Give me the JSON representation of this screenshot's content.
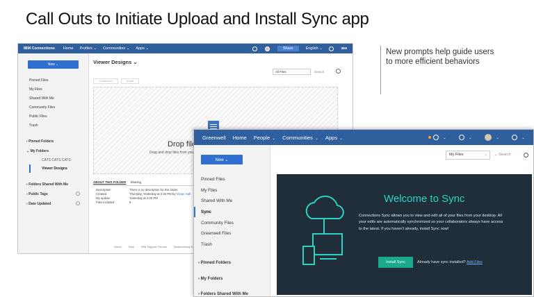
{
  "slide": {
    "title": "Call Outs to Initiate Upload and Install Sync app",
    "callout": "New prompts help guide users to more efficient behaviors"
  },
  "back_window": {
    "nav": {
      "brand": "IBM Connections",
      "items": [
        "Home",
        "Profiles ⌄",
        "Communities ⌄",
        "Apps ⌄"
      ],
      "share": "Share",
      "language": "English ⌄",
      "ibm_logo": "IBM"
    },
    "sidebar": {
      "new_button": "New ⌄",
      "items": [
        "Pinned Files",
        "My Files",
        "Shared With Me",
        "Community Files",
        "Public Files",
        "Trash"
      ],
      "pinned_folders": "Pinned Folders",
      "my_folders": "My Folders",
      "folder_items": [
        "CATS CATS CATS",
        "Viewer Designs"
      ],
      "folders_shared": "Folders Shared With Me",
      "public_tags": "Public Tags",
      "date_updated": "Date Updated"
    },
    "main": {
      "heading": "Viewer Designs ⌄",
      "filter": "All Files",
      "search_placeholder": "Search",
      "btn1": "Download",
      "btn2": "Share",
      "drop_title": "Drop files here",
      "drop_sub": "Drag and drop files from your desktop",
      "tab_about": "ABOUT THIS FOLDER",
      "tab_sharing": "Sharing",
      "about": [
        {
          "k": "Description",
          "v": "There is no description for this folder."
        },
        {
          "k": "Created",
          "v": "Thursday, Yesterday at 2:20 PM by",
          "link": "Vivian Hall"
        },
        {
          "k": "My update",
          "v": "Yesterday at 2:20 PM"
        },
        {
          "k": "Files included",
          "v": "9"
        }
      ],
      "footer": [
        "Home",
        "Help",
        "IBM Support Forums",
        "Bookmarking Tools",
        "About"
      ]
    }
  },
  "front_window": {
    "nav": {
      "brand": "Greenwell",
      "items": [
        "Home",
        "People",
        "Communities",
        "Apps"
      ]
    },
    "sidebar": {
      "new_button": "New ⌄",
      "items": [
        "Pinned Files",
        "My Files",
        "Shared With Me",
        "Sync",
        "Community Files",
        "Greenwell Files",
        "Trash"
      ],
      "selected": "Sync",
      "pinned_folders": "Pinned Folders",
      "my_folders": "My Folders",
      "folders_shared": "Folders Shared With Me"
    },
    "filter": "My Files",
    "search_placeholder": "Search",
    "panel": {
      "title": "Welcome to Sync",
      "body": "Connections Sync allows you to view and edit all of your files from your desktop. All your edits are automatically synchronized so your collaborators always have access to the latest. If you haven't already, install Sync now!",
      "install_button": "Install Sync",
      "question": "Already have sync installed?",
      "add_files_link": "Add Files"
    }
  }
}
